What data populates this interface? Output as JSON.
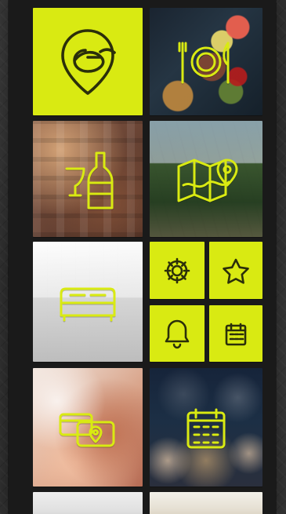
{
  "theme": {
    "accent": "#d9ea12",
    "accent_dark": "#2b2f0a",
    "outline": "#d9ea12",
    "frame_bg": "#1a1a1a"
  },
  "tiles": [
    {
      "name": "brand-logo-tile",
      "icon": "location-e-logo-icon",
      "interactable": false
    },
    {
      "name": "food-tile",
      "icon": "plate-cutlery-icon",
      "interactable": true
    },
    {
      "name": "wine-tile",
      "icon": "wine-bottle-glass-icon",
      "interactable": true
    },
    {
      "name": "map-tile",
      "icon": "map-pin-icon",
      "interactable": true
    },
    {
      "name": "accommodation-tile",
      "icon": "bed-icon",
      "interactable": true
    },
    {
      "name": "settings-tile",
      "icon": "gear-icon",
      "interactable": true
    },
    {
      "name": "favorites-tile",
      "icon": "star-icon",
      "interactable": true
    },
    {
      "name": "notifications-tile",
      "icon": "bell-icon",
      "interactable": true
    },
    {
      "name": "calendar-tile",
      "icon": "calendar-icon",
      "interactable": true
    },
    {
      "name": "payment-tile",
      "icon": "payment-card-location-icon",
      "interactable": true
    },
    {
      "name": "events-tile",
      "icon": "calendar-large-icon",
      "interactable": true
    },
    {
      "name": "more-tile-left",
      "icon": "",
      "interactable": true
    },
    {
      "name": "more-tile-right",
      "icon": "",
      "interactable": true
    }
  ]
}
